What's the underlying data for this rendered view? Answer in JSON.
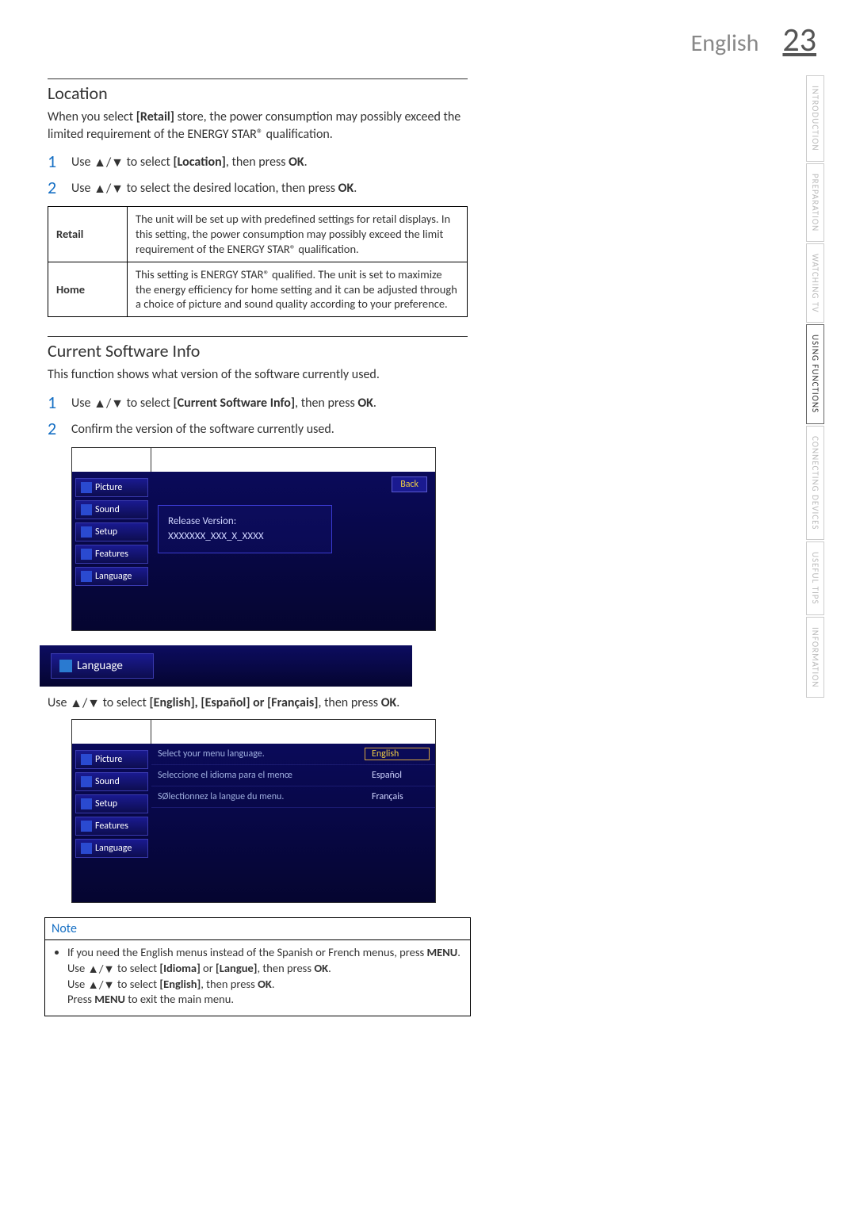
{
  "header": {
    "language": "English",
    "page_number": "23"
  },
  "side_tabs": [
    {
      "label": "INTRODUCTION",
      "active": false
    },
    {
      "label": "PREPARATION",
      "active": false
    },
    {
      "label": "WATCHING TV",
      "active": false
    },
    {
      "label": "USING FUNCTIONS",
      "active": true
    },
    {
      "label": "CONNECTING DEVICES",
      "active": false
    },
    {
      "label": "USEFUL TIPS",
      "active": false
    },
    {
      "label": "INFORMATION",
      "active": false
    }
  ],
  "location": {
    "title": "Location",
    "intro_a": "When you select ",
    "intro_bold": "[Retail]",
    "intro_b": " store, the power consumption may possibly exceed the limited requirement of the ENERGY STAR® qualification.",
    "steps": [
      {
        "num": "1",
        "pre": "Use ",
        "arrows": "▲/▼",
        "mid": " to select ",
        "bold": "[Location]",
        "post": ", then press ",
        "bold2": "OK",
        "tail": "."
      },
      {
        "num": "2",
        "pre": "Use ",
        "arrows": "▲/▼",
        "mid": " to select the desired location, then press ",
        "bold": "OK",
        "post": ".",
        "bold2": "",
        "tail": ""
      }
    ],
    "table": [
      {
        "label": "Retail",
        "desc": "The unit will be set up with predefined settings for retail displays. In this setting, the power consumption may possibly exceed the limit requirement of the ENERGY STAR® qualification."
      },
      {
        "label": "Home",
        "desc": "This setting is ENERGY STAR® qualified. The unit is set to maximize the energy efficiency for home setting and it can be adjusted through a choice of picture and sound quality according to your preference."
      }
    ]
  },
  "software": {
    "title": "Current Software Info",
    "intro": "This function shows what version of the software currently used.",
    "steps": [
      {
        "num": "1",
        "pre": "Use ",
        "arrows": "▲/▼",
        "mid": " to select ",
        "bold": "[Current Software Info]",
        "post": ", then press ",
        "bold2": "OK",
        "tail": "."
      },
      {
        "num": "2",
        "pre": "Confirm the version of the software currently used.",
        "arrows": "",
        "mid": "",
        "bold": "",
        "post": "",
        "bold2": "",
        "tail": ""
      }
    ],
    "menu": {
      "items": [
        "Picture",
        "Sound",
        "Setup",
        "Features",
        "Language"
      ],
      "back": "Back",
      "release_label": "Release Version:",
      "release_value": "XXXXXXX_XXX_X_XXXX"
    }
  },
  "language": {
    "bar_label": "Language",
    "instruction_pre": "Use ",
    "instruction_arrows": "▲/▼",
    "instruction_mid": " to select ",
    "instruction_opts": "[English], [Español] or [Français]",
    "instruction_post": ", then press ",
    "instruction_bold": "OK",
    "instruction_tail": ".",
    "menu": {
      "items": [
        "Picture",
        "Sound",
        "Setup",
        "Features",
        "Language"
      ],
      "rows": [
        {
          "prompt": "Select your menu language.",
          "opt": "English",
          "selected": true
        },
        {
          "prompt": "Seleccione el idioma para el menœ",
          "opt": "Español",
          "selected": false
        },
        {
          "prompt": "SØlectionnez la langue du menu.",
          "opt": "Français",
          "selected": false
        }
      ]
    }
  },
  "note": {
    "header": "Note",
    "line1_a": "If you need the English menus instead of the Spanish or French menus, press ",
    "line1_b": "MENU",
    "line1_c": ". Use ",
    "line1_arrows": "▲/▼",
    "line1_d": " to select ",
    "line1_e": "[Idioma]",
    "line1_f": " or ",
    "line1_g": "[Langue]",
    "line1_h": ", then press ",
    "line1_i": "OK",
    "line1_j": ".",
    "line2_a": "Use ",
    "line2_arrows": "▲/▼",
    "line2_b": " to select ",
    "line2_c": "[English]",
    "line2_d": ", then press ",
    "line2_e": "OK",
    "line2_f": ".",
    "line3_a": "Press ",
    "line3_b": "MENU",
    "line3_c": " to exit the main menu."
  }
}
